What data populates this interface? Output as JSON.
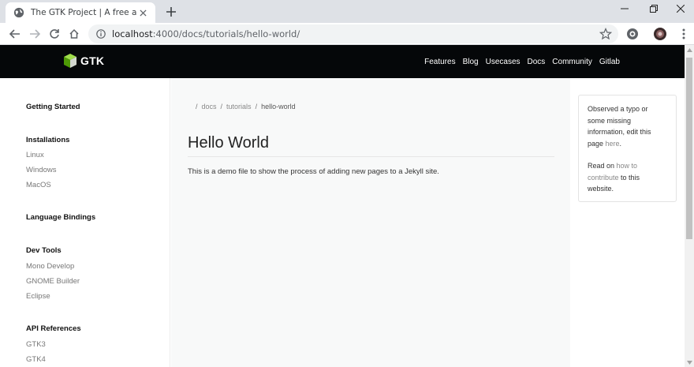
{
  "browser": {
    "tab_title": "The GTK Project | A free and ope",
    "url_host": "localhost",
    "url_rest": ":4000/docs/tutorials/hello-world/"
  },
  "site": {
    "brand": "GTK",
    "nav": [
      "Features",
      "Blog",
      "Usecases",
      "Docs",
      "Community",
      "Gitlab"
    ]
  },
  "sidebar": {
    "sections": [
      {
        "heading": "Getting Started",
        "items": []
      },
      {
        "heading": "Installations",
        "items": [
          "Linux",
          "Windows",
          "MacOS"
        ]
      },
      {
        "heading": "Language Bindings",
        "items": []
      },
      {
        "heading": "Dev Tools",
        "items": [
          "Mono Develop",
          "GNOME Builder",
          "Eclipse"
        ]
      },
      {
        "heading": "API References",
        "items": [
          "GTK3",
          "GTK4"
        ]
      }
    ]
  },
  "breadcrumb": {
    "items": [
      "docs",
      "tutorials",
      "hello-world"
    ]
  },
  "page": {
    "title": "Hello World",
    "body": "This is a demo file to show the process of adding new pages to a Jekyll site."
  },
  "card": {
    "p1_prefix": "Observed a typo or some missing information, edit this page ",
    "p1_link": "here",
    "p1_suffix": ".",
    "p2_prefix": "Read on ",
    "p2_link": "how to contribute",
    "p2_suffix": " to this website."
  },
  "colors": {
    "navbar_bg": "#050709",
    "content_bg": "#f8f9f9"
  }
}
